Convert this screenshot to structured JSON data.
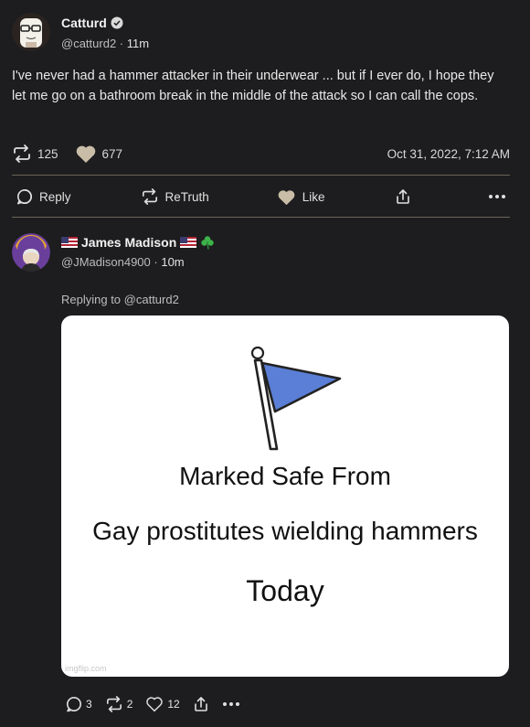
{
  "post": {
    "author_name": "Catturd",
    "handle": "@catturd2",
    "time": "11m",
    "text": "I've never had a hammer attacker in their underwear ... but if I ever do, I hope they let me go on a bathroom break in the middle of the attack so I can call the cops.",
    "retruths": "125",
    "likes": "677",
    "date": "Oct 31, 2022, 7:12 AM",
    "actions": {
      "reply": "Reply",
      "retruth": "ReTruth",
      "like": "Like"
    }
  },
  "reply": {
    "author_name": "James Madison",
    "handle": "@JMadison4900",
    "time": "10m",
    "replying_to": "Replying to @catturd2",
    "meme": {
      "line1": "Marked Safe From",
      "line2": "Gay prostitutes wielding hammers",
      "line3": "Today",
      "watermark": "imgflip.com"
    },
    "counts": {
      "replies": "3",
      "retruths": "2",
      "likes": "12"
    }
  },
  "colors": {
    "background": "#1d1d1f",
    "flag_blue": "#5b7fd6",
    "divider": "#6b6558"
  }
}
